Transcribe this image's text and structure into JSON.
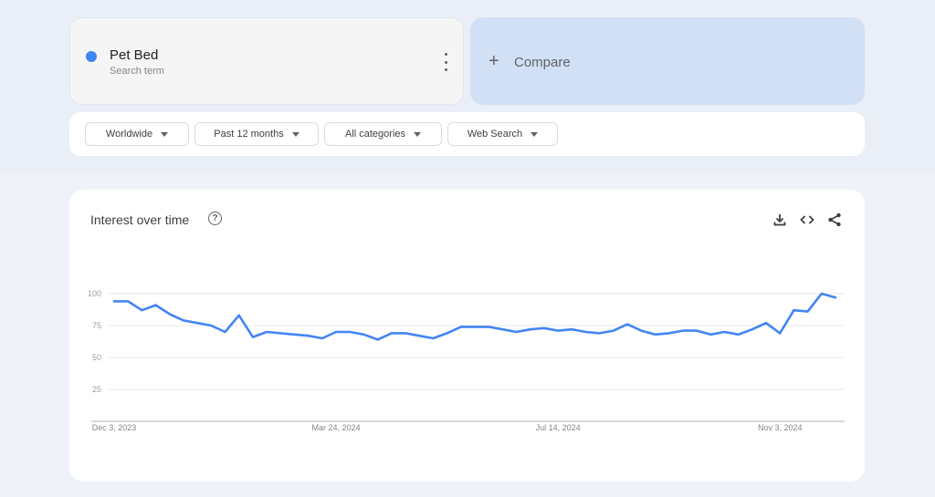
{
  "search_term": {
    "name": "Pet Bed",
    "subtitle": "Search term",
    "color": "#4285f4"
  },
  "compare": {
    "icon": "+",
    "label": "Compare"
  },
  "filters": [
    {
      "label": "Worldwide"
    },
    {
      "label": "Past 12 months"
    },
    {
      "label": "All categories"
    },
    {
      "label": "Web Search"
    }
  ],
  "panel": {
    "title": "Interest over time",
    "help_icon": "?",
    "actions": [
      "download-icon",
      "embed-code-icon",
      "share-icon"
    ]
  },
  "chart_data": {
    "type": "line",
    "title": "Interest over time",
    "xlabel": "",
    "ylabel": "",
    "ylim": [
      0,
      100
    ],
    "yticks": [
      25,
      50,
      75,
      100
    ],
    "xtick_labels": [
      "Dec 3, 2023",
      "Mar 24, 2024",
      "Jul 14, 2024",
      "Nov 3, 2024"
    ],
    "xtick_indices": [
      0,
      16,
      32,
      48
    ],
    "grid": true,
    "legend": "none",
    "series": [
      {
        "name": "Pet Bed",
        "color": "#4285f4",
        "values": [
          94,
          94,
          87,
          91,
          84,
          79,
          77,
          75,
          70,
          83,
          66,
          70,
          69,
          68,
          67,
          65,
          70,
          70,
          68,
          64,
          69,
          69,
          67,
          65,
          69,
          74,
          74,
          74,
          72,
          70,
          72,
          73,
          71,
          72,
          70,
          69,
          71,
          76,
          71,
          68,
          69,
          71,
          71,
          68,
          70,
          68,
          72,
          77,
          69,
          87,
          86,
          100,
          97
        ]
      }
    ]
  }
}
